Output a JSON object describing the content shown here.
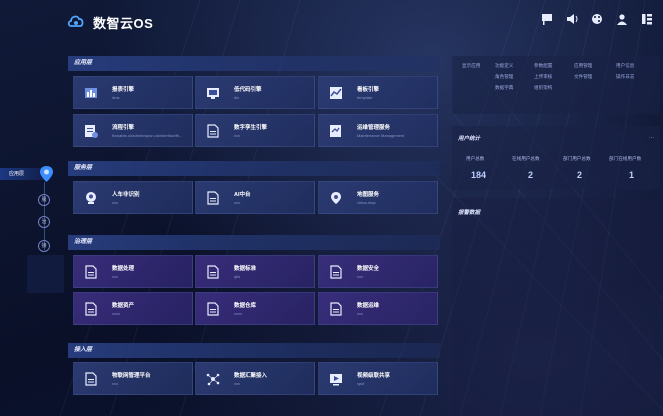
{
  "header": {
    "app_title": "数智云OS",
    "icons": [
      "flag-icon",
      "volume-icon",
      "palette-icon",
      "user-icon",
      "grid-menu-icon"
    ]
  },
  "rail": {
    "active_label": "应用层",
    "items": [
      "服",
      "治",
      "接"
    ]
  },
  "sections": {
    "app_layer": "应用层",
    "service_layer": "服务层",
    "governance_layer": "治理层",
    "access_layer": "接入层"
  },
  "app_cards": [
    {
      "title": "报表引擎",
      "sub": "dms",
      "icon": "report-icon"
    },
    {
      "title": "低代码引擎",
      "sub": "dlx",
      "icon": "lowcode-icon"
    },
    {
      "title": "看板引擎",
      "sub": "template",
      "icon": "dashboard-chart-icon"
    },
    {
      "title": "流程引擎",
      "sub": "flowable-ui/admin/wpsn-xd/wireflow/fb...",
      "icon": "workflow-icon"
    },
    {
      "title": "数字孪生引擎",
      "sub": "xxx",
      "icon": "document-icon"
    },
    {
      "title": "运维管理服务",
      "sub": "Maintenance Management",
      "icon": "ops-icon"
    }
  ],
  "service_cards": [
    {
      "title": "人车非识别",
      "sub": "xxx",
      "icon": "recognition-icon"
    },
    {
      "title": "AI中台",
      "sub": "xxx",
      "icon": "document-icon"
    },
    {
      "title": "地图服务",
      "sub": "china-map",
      "icon": "map-pin-icon"
    }
  ],
  "governance_cards": [
    {
      "title": "数据处理",
      "sub": "xxx",
      "icon": "document-icon"
    },
    {
      "title": "数据标准",
      "sub": "qlts",
      "icon": "document-icon"
    },
    {
      "title": "数据安全",
      "sub": "xxx",
      "icon": "document-icon"
    },
    {
      "title": "数据资产",
      "sub": "xxxx",
      "icon": "document-icon"
    },
    {
      "title": "数据仓库",
      "sub": "xxxx",
      "icon": "document-icon"
    },
    {
      "title": "数据运维",
      "sub": "xxx",
      "icon": "document-icon"
    }
  ],
  "access_cards": [
    {
      "title": "物联网管理平台",
      "sub": "xxx",
      "icon": "document-icon"
    },
    {
      "title": "数据汇聚接入",
      "sub": "xxx",
      "icon": "network-icon"
    },
    {
      "title": "视频级联共享",
      "sub": "vpsf",
      "icon": "video-icon"
    }
  ],
  "quick_links": {
    "title": "显示应用",
    "items": [
      "功能定义",
      "参数配置",
      "应用管理",
      "用户信息",
      "角色管理",
      "上传审核",
      "文件管理",
      "操作日志",
      "数据字典",
      "组织架构"
    ]
  },
  "user_stats": {
    "title": "用户统计",
    "more": "...",
    "labels": [
      "用户总数",
      "在线用户总数",
      "部门用户总数",
      "部门在线用户数"
    ],
    "values": [
      "184",
      "2",
      "2",
      "1"
    ]
  },
  "alerts": {
    "title": "报警数据"
  }
}
